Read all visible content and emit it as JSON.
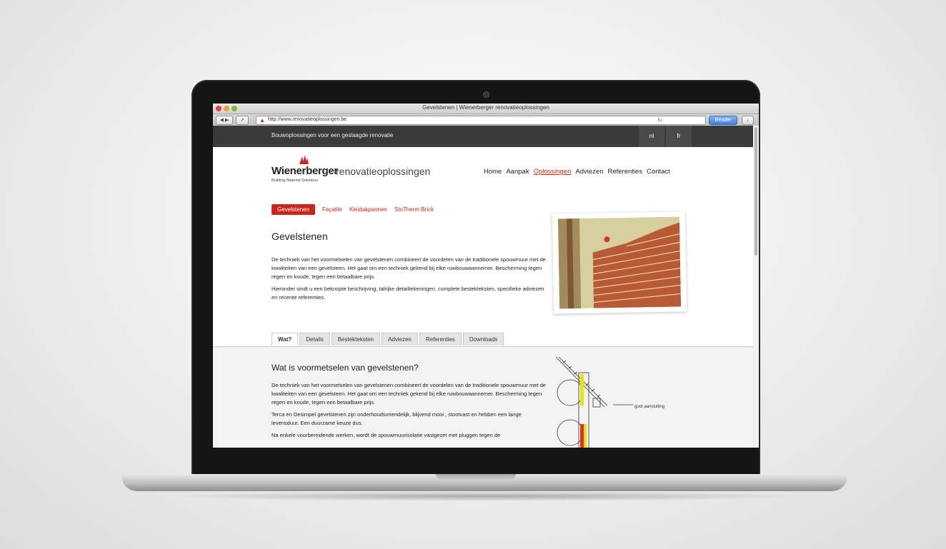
{
  "browser": {
    "window_title": "Gevelstenen | Wienerberger renovatieoplossingen",
    "url": "http://www.renovatieoplossingen.be",
    "reader_label": "Reader"
  },
  "site": {
    "top_bar_text": "Bouwoplossingen voor een geslaagde renovatie",
    "languages": [
      "nl",
      "fr"
    ],
    "logo": {
      "brand": "Wienerberger",
      "product": "renovatieoplossingen",
      "tagline": "Building Material Solutions"
    },
    "nav": [
      "Home",
      "Aanpak",
      "Oplossingen",
      "Adviezen",
      "Referenties",
      "Contact"
    ],
    "nav_active": "Oplossingen",
    "subtabs": [
      "Gevelstenen",
      "Façatile",
      "Kleidakpannen",
      "StoTherm Brick"
    ],
    "subtab_active": "Gevelstenen"
  },
  "content": {
    "title": "Gevelstenen",
    "intro_p1": "De techniek van het voormetselen van gevelstenen combineert de voordelen van de traditionele spouwmuur met de kwaliteiten van een gevelsteen. Het gaat om een techniek gekend bij elke ruwbouwaannemer. Bescherming tegen regen en koude, tegen een betaalbare prijs.",
    "intro_p2": "Hieronder vindt u een beknopte beschrijving, talrijke detailtekeningen, complete bestekteksten, specifieke adviezen en recente referenties.",
    "tabs": [
      "Wat?",
      "Details",
      "Bestekteksten",
      "Adviezen",
      "Referenties",
      "Downloads"
    ],
    "tab_active": "Wat?",
    "section_title": "Wat is voormetselen van gevelstenen?",
    "section_p1": "De techniek van het voormetselen van gevelstenen combineert de voordelen van de traditionele spouwmuur met de kwaliteiten van een gevelsteen. Het gaat om een techniek gekend bij elke ruwbouwaannemer. Bescherming tegen regen en koude, tegen een betaalbare prijs.",
    "section_p2": "Terca en Desimpel gevelstenen zijn onderhoudsvriendelijk, blijvend mooi , stootvast en hebben een lange levensduur. Een duurzame keuze dus.",
    "section_p3": "Na enkele voorbereidende werken, wordt de spouwmuurisolatie vastgezet met pluggen tegen de",
    "diagram_label": "goot aansluiting"
  },
  "colors": {
    "accent": "#c8261b",
    "topbar": "#3a3a3a"
  }
}
